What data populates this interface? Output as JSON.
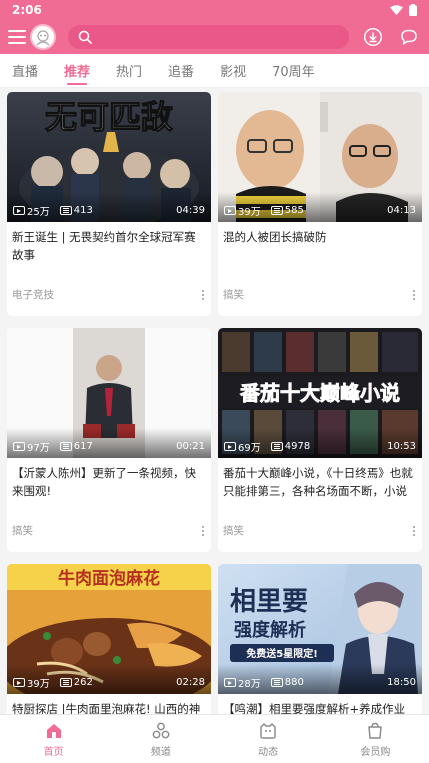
{
  "status_bar": {
    "time": "2:06"
  },
  "search": {
    "placeholder": ""
  },
  "tabs": [
    {
      "label": "直播",
      "active": false
    },
    {
      "label": "推荐",
      "active": true
    },
    {
      "label": "热门",
      "active": false
    },
    {
      "label": "追番",
      "active": false
    },
    {
      "label": "影视",
      "active": false
    },
    {
      "label": "70周年",
      "active": false
    }
  ],
  "cards": [
    {
      "views": "25万",
      "danmaku": "413",
      "duration": "04:39",
      "title": "新王诞生 | 无畏契约首尔全球冠军赛故事",
      "category": "电子竞技",
      "thumb_text": "无可匹敌"
    },
    {
      "views": "39万",
      "danmaku": "585",
      "duration": "04:13",
      "title": "混的人被团长搞破防",
      "category": "搞笑",
      "thumb_text": ""
    },
    {
      "views": "97万",
      "danmaku": "617",
      "duration": "00:21",
      "title": "【沂蒙人陈州】更新了一条视频，快来围观!",
      "category": "搞笑",
      "thumb_text": ""
    },
    {
      "views": "69万",
      "danmaku": "4978",
      "duration": "10:53",
      "title": "番茄十大巅峰小说，《十日终焉》也就只能排第三，各种名场面不断，小说这",
      "category": "搞笑",
      "thumb_text": "番茄十大巅峰小说"
    },
    {
      "views": "39万",
      "danmaku": "262",
      "duration": "02:28",
      "title": "特厨探店 |牛肉面里泡麻花! 山西的神奇",
      "category": "",
      "thumb_text": "牛肉面泡麻花"
    },
    {
      "views": "28万",
      "danmaku": "880",
      "duration": "18:50",
      "title": "【鸣潮】相里要强度解析+养成作业 声",
      "category": "",
      "thumb_text": "相里要",
      "thumb_text2": "强度解析",
      "thumb_badge": "免费送5星限定!"
    }
  ],
  "bottom_nav": [
    {
      "label": "首页",
      "active": true,
      "icon": "home-icon"
    },
    {
      "label": "频道",
      "active": false,
      "icon": "channel-icon"
    },
    {
      "label": "动态",
      "active": false,
      "icon": "dynamic-icon"
    },
    {
      "label": "会员购",
      "active": false,
      "icon": "shop-icon"
    }
  ],
  "colors": {
    "brand": "#f06c95",
    "brand_dark": "#e95888"
  }
}
